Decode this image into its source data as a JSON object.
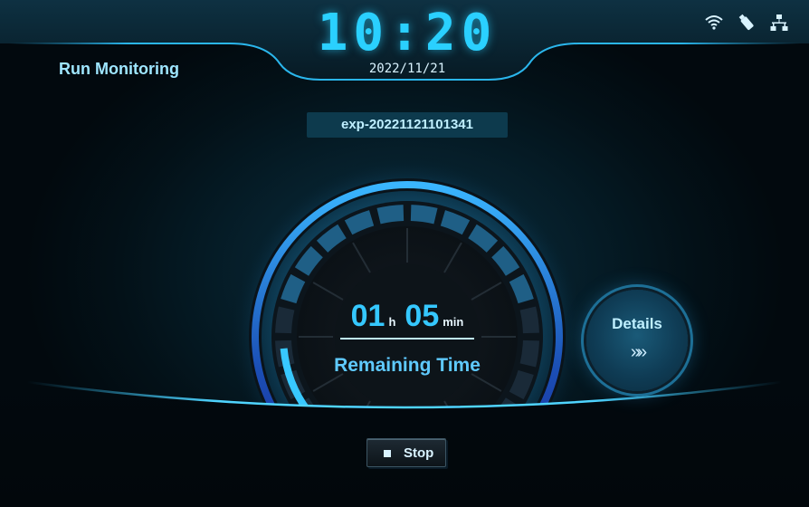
{
  "header": {
    "page_title": "Run Monitoring",
    "clock": "10:20",
    "date": "2022/11/21",
    "status_icons": [
      "wifi-icon",
      "usb-icon",
      "network-icon"
    ]
  },
  "experiment": {
    "id": "exp-20221121101341"
  },
  "timer": {
    "hours": "01",
    "hours_unit": "h",
    "minutes": "05",
    "minutes_unit": "min",
    "label": "Remaining Time",
    "progress_fraction": 0.35
  },
  "details_button": {
    "label": "Details",
    "chevron": "»»"
  },
  "stop_button": {
    "label": "Stop"
  },
  "colors": {
    "accent": "#2ad0ff",
    "background": "#02090e",
    "panel": "#0d3a4d",
    "text_light": "#d9f3ff"
  }
}
